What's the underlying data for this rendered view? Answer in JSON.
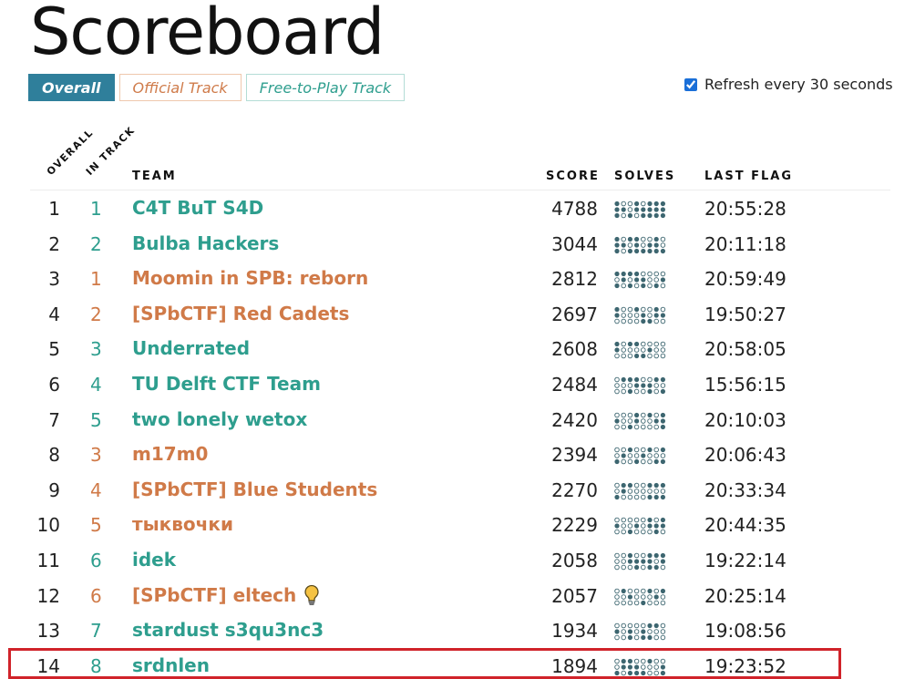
{
  "page": {
    "title": "Scoreboard"
  },
  "tabs": [
    {
      "label": "Overall",
      "active": true
    },
    {
      "label": "Official Track",
      "active": false
    },
    {
      "label": "Free-to-Play Track",
      "active": false
    }
  ],
  "refresh": {
    "label": "Refresh every 30 seconds",
    "checked": true
  },
  "columns": {
    "overall": "OVERALL",
    "in_track": "IN TRACK",
    "team": "TEAM",
    "score": "SCORE",
    "solves": "SOLVES",
    "last_flag": "LAST FLAG"
  },
  "colors": {
    "official": "#d07a48",
    "free": "#2e9e8e",
    "accent": "#2f7f9b",
    "highlight": "#d0232a"
  },
  "rows": [
    {
      "overall": "1",
      "track": "1",
      "team": "C4T BuT S4D",
      "score": "4788",
      "last_flag": "20:55:28",
      "track_type": "free"
    },
    {
      "overall": "2",
      "track": "2",
      "team": "Bulba Hackers",
      "score": "3044",
      "last_flag": "20:11:18",
      "track_type": "free"
    },
    {
      "overall": "3",
      "track": "1",
      "team": "Moomin in SPB: reborn",
      "score": "2812",
      "last_flag": "20:59:49",
      "track_type": "official"
    },
    {
      "overall": "4",
      "track": "2",
      "team": "[SPbCTF] Red Cadets",
      "score": "2697",
      "last_flag": "19:50:27",
      "track_type": "official"
    },
    {
      "overall": "5",
      "track": "3",
      "team": "Underrated",
      "score": "2608",
      "last_flag": "20:58:05",
      "track_type": "free"
    },
    {
      "overall": "6",
      "track": "4",
      "team": "TU Delft CTF Team",
      "score": "2484",
      "last_flag": "15:56:15",
      "track_type": "free"
    },
    {
      "overall": "7",
      "track": "5",
      "team": "two lonely wetox",
      "score": "2420",
      "last_flag": "20:10:03",
      "track_type": "free"
    },
    {
      "overall": "8",
      "track": "3",
      "team": "m17m0",
      "score": "2394",
      "last_flag": "20:06:43",
      "track_type": "official"
    },
    {
      "overall": "9",
      "track": "4",
      "team": "[SPbCTF] Blue Students",
      "score": "2270",
      "last_flag": "20:33:34",
      "track_type": "official"
    },
    {
      "overall": "10",
      "track": "5",
      "team": "тыквочки",
      "score": "2229",
      "last_flag": "20:44:35",
      "track_type": "official"
    },
    {
      "overall": "11",
      "track": "6",
      "team": "idek",
      "score": "2058",
      "last_flag": "19:22:14",
      "track_type": "free"
    },
    {
      "overall": "12",
      "track": "6",
      "team": "[SPbCTF] eltech",
      "score": "2057",
      "last_flag": "20:25:14",
      "track_type": "official",
      "icon": "lightbulb-icon"
    },
    {
      "overall": "13",
      "track": "7",
      "team": "stardust s3qu3nc3",
      "score": "1934",
      "last_flag": "19:08:56",
      "track_type": "free"
    },
    {
      "overall": "14",
      "track": "8",
      "team": "srdnlen",
      "score": "1894",
      "last_flag": "19:23:52",
      "track_type": "free",
      "highlighted": true
    }
  ]
}
